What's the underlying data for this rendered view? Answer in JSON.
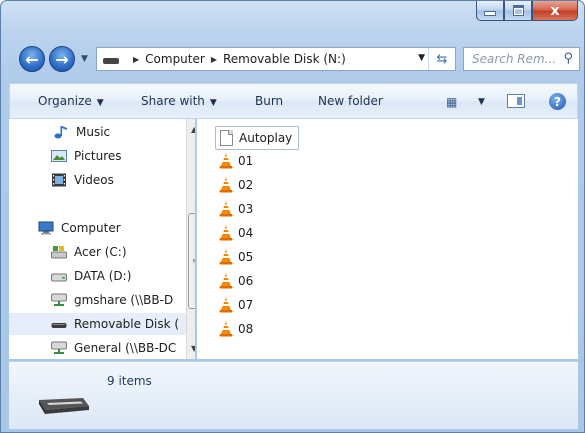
{
  "window": {
    "caption_close": "x"
  },
  "address": {
    "crumbs": [
      "Computer",
      "Removable Disk (N:)"
    ]
  },
  "search": {
    "placeholder": "Search Rem..."
  },
  "toolbar": {
    "organize": "Organize",
    "share_with": "Share with",
    "burn": "Burn",
    "new_folder": "New folder"
  },
  "nav": {
    "items": [
      {
        "label": "Music",
        "icon": "music-icon"
      },
      {
        "label": "Pictures",
        "icon": "pictures-icon"
      },
      {
        "label": "Videos",
        "icon": "videos-icon"
      },
      {
        "label": "Computer",
        "icon": "computer-icon"
      },
      {
        "label": "Acer (C:)",
        "icon": "system-drive-icon"
      },
      {
        "label": "DATA (D:)",
        "icon": "drive-icon"
      },
      {
        "label": "gmshare (\\\\BB-D",
        "icon": "network-drive-icon"
      },
      {
        "label": "Removable Disk (",
        "icon": "removable-disk-icon",
        "selected": true
      },
      {
        "label": "General (\\\\BB-DC",
        "icon": "network-drive-icon"
      }
    ]
  },
  "files": [
    {
      "name": "Autoplay",
      "icon": "document-icon",
      "selected": true
    },
    {
      "name": "01",
      "icon": "vlc-cone-icon"
    },
    {
      "name": "02",
      "icon": "vlc-cone-icon"
    },
    {
      "name": "03",
      "icon": "vlc-cone-icon"
    },
    {
      "name": "04",
      "icon": "vlc-cone-icon"
    },
    {
      "name": "05",
      "icon": "vlc-cone-icon"
    },
    {
      "name": "06",
      "icon": "vlc-cone-icon"
    },
    {
      "name": "07",
      "icon": "vlc-cone-icon"
    },
    {
      "name": "08",
      "icon": "vlc-cone-icon"
    }
  ],
  "status": {
    "items_text": "9 items"
  },
  "colors": {
    "accent": "#2c6cc7",
    "selection": "#e5eefa",
    "vlc_orange": "#f08a00"
  }
}
